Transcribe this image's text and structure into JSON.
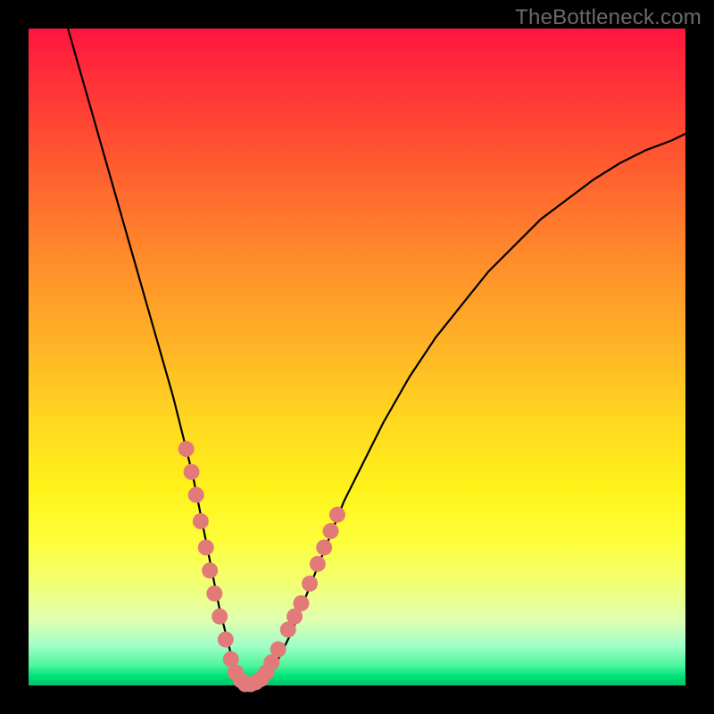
{
  "watermark": "TheBottleneck.com",
  "chart_data": {
    "type": "line",
    "title": "",
    "xlabel": "",
    "ylabel": "",
    "xlim": [
      0,
      100
    ],
    "ylim": [
      0,
      100
    ],
    "grid": false,
    "background_gradient": {
      "direction": "vertical",
      "stops": [
        {
          "pos": 0,
          "color": "#ff153f"
        },
        {
          "pos": 50,
          "color": "#ffb326"
        },
        {
          "pos": 80,
          "color": "#fdff3a"
        },
        {
          "pos": 100,
          "color": "#00c46a"
        }
      ]
    },
    "series": [
      {
        "name": "bottleneck-curve",
        "color": "#000000",
        "x": [
          6,
          8,
          10,
          12,
          14,
          16,
          18,
          20,
          22,
          24,
          25,
          26,
          27,
          28,
          29,
          30,
          31,
          32,
          33,
          34,
          35,
          36,
          38,
          40,
          42,
          44,
          46,
          48,
          50,
          54,
          58,
          62,
          66,
          70,
          74,
          78,
          82,
          86,
          90,
          94,
          98,
          100
        ],
        "y": [
          100,
          93,
          86,
          79,
          72,
          65,
          58,
          51,
          44,
          36,
          32,
          27,
          22,
          17,
          12,
          8,
          4,
          1,
          0,
          0,
          0,
          1,
          4,
          8,
          13,
          18,
          23,
          28,
          32,
          40,
          47,
          53,
          58,
          63,
          67,
          71,
          74,
          77,
          79.5,
          81.5,
          83,
          84
        ]
      },
      {
        "name": "highlight-dots",
        "type": "scatter",
        "color": "#e37a7a",
        "radius": 9,
        "x": [
          24.0,
          24.8,
          25.5,
          26.2,
          27.0,
          27.6,
          28.3,
          29.1,
          30.0,
          30.8,
          31.5,
          32.3,
          33.0,
          33.8,
          34.6,
          35.4,
          36.2,
          37.0,
          38.0,
          39.5,
          40.5,
          41.5,
          42.8,
          44.0,
          45.0,
          46.0,
          47.0
        ],
        "y": [
          36.0,
          32.5,
          29.0,
          25.0,
          21.0,
          17.5,
          14.0,
          10.5,
          7.0,
          4.0,
          2.0,
          0.8,
          0.2,
          0.2,
          0.5,
          1.0,
          2.0,
          3.5,
          5.5,
          8.5,
          10.5,
          12.5,
          15.5,
          18.5,
          21.0,
          23.5,
          26.0
        ]
      }
    ]
  }
}
